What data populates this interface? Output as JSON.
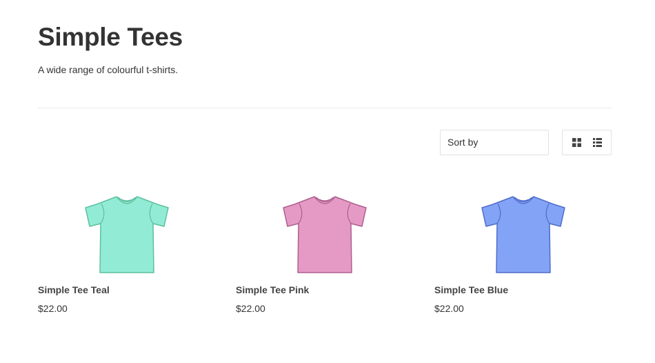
{
  "collection": {
    "title": "Simple Tees",
    "description": "A wide range of colourful t-shirts."
  },
  "toolbar": {
    "sort_label": "Sort by",
    "grid_view_icon": "grid-view-icon",
    "list_view_icon": "list-view-icon"
  },
  "products": [
    {
      "name": "Simple Tee Teal",
      "price": "$22.00",
      "fill": "#92ecd5",
      "stroke": "#5cbf9e"
    },
    {
      "name": "Simple Tee Pink",
      "price": "$22.00",
      "fill": "#e49ac5",
      "stroke": "#ad5f8e"
    },
    {
      "name": "Simple Tee Blue",
      "price": "$22.00",
      "fill": "#83a3f7",
      "stroke": "#4f6cc8"
    }
  ],
  "colors": {
    "text": "#333333",
    "border": "#e1e1e1",
    "icon": "#444444"
  }
}
